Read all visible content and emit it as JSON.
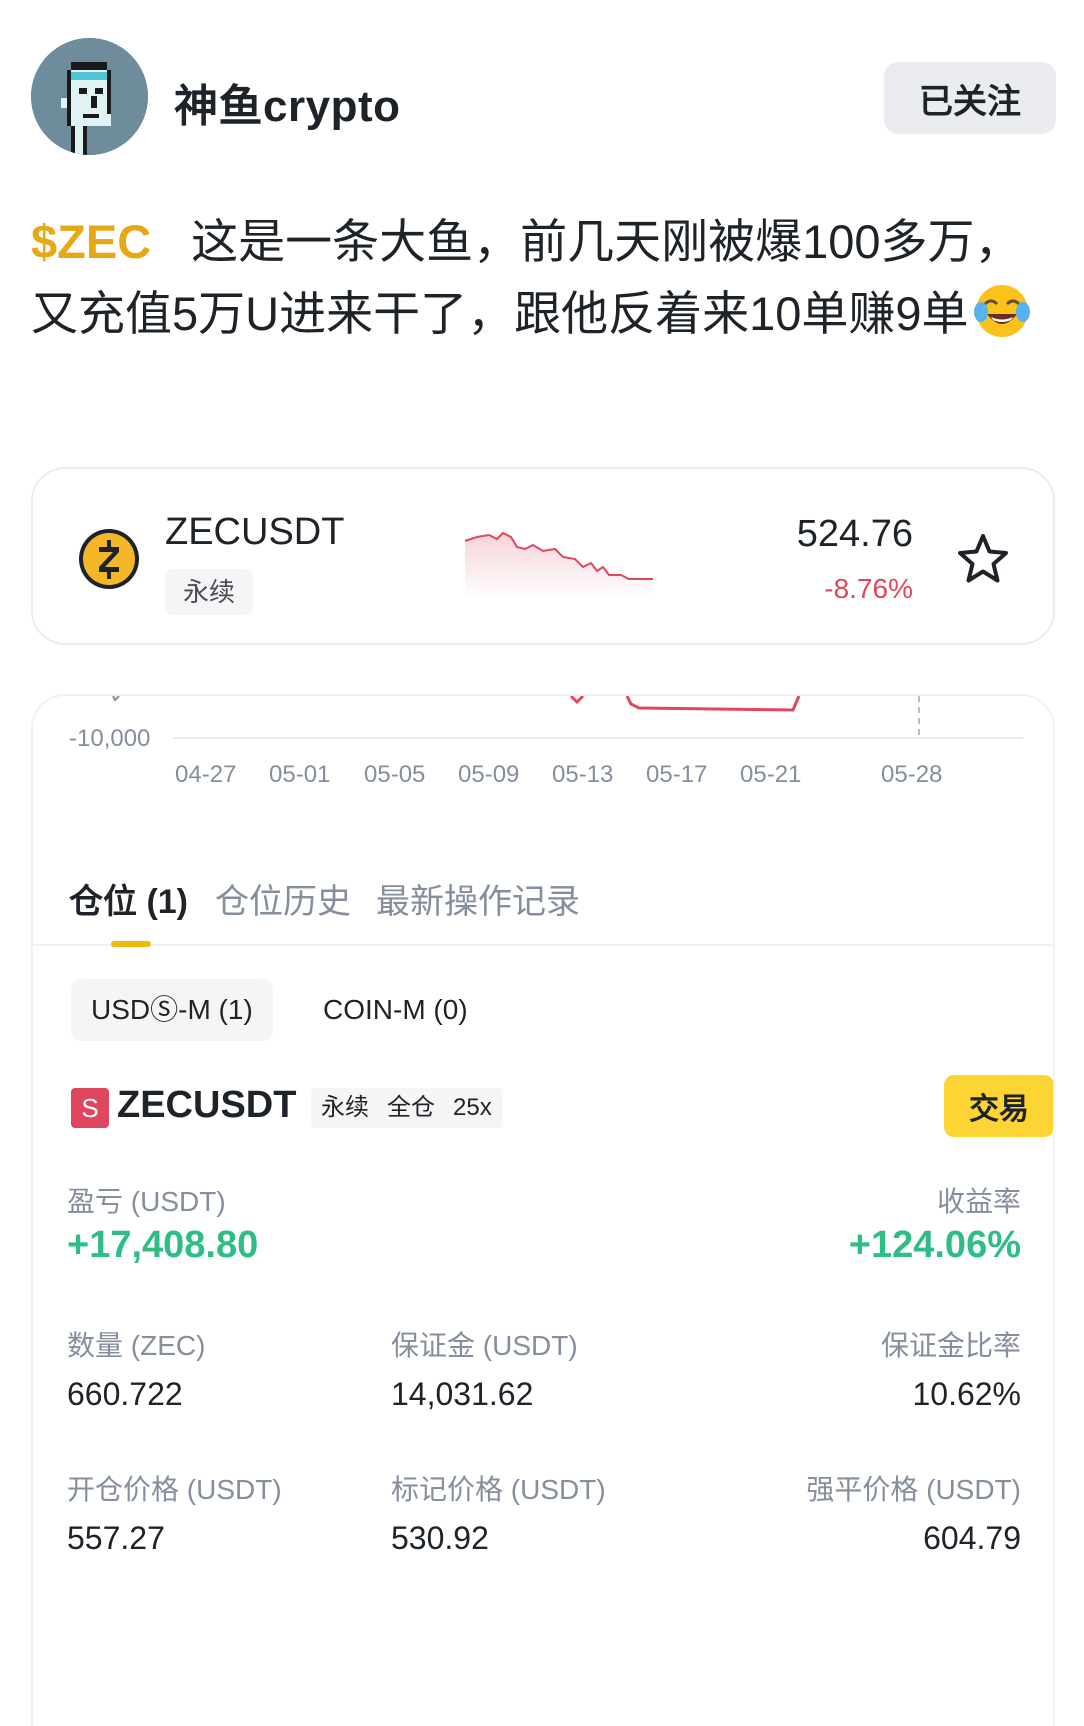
{
  "header": {
    "username": "神鱼crypto",
    "follow_label": "已关注"
  },
  "post": {
    "ticker": "$ZEC",
    "text": "这是一条大鱼，前几天刚被爆100多万，又充值5万U进来干了，跟他反着来10单赚9单",
    "emoji": "face-with-tears-of-joy"
  },
  "ticker_card": {
    "pair": "ZECUSDT",
    "type_tag": "永续",
    "price": "524.76",
    "change": "-8.76%",
    "change_color": "#e0475e"
  },
  "chart_data": {
    "type": "line",
    "y_visible_tick": "-10,000",
    "x_ticks": [
      "04-27",
      "05-01",
      "05-05",
      "05-09",
      "05-13",
      "05-17",
      "05-21",
      "05-28"
    ]
  },
  "tabs": {
    "positions": "仓位 (1)",
    "history": "仓位历史",
    "latest": "最新操作记录"
  },
  "subtabs": {
    "usds_m": "USDⓈ-M (1)",
    "coin_m": "COIN-M (0)"
  },
  "position": {
    "side_badge": "S",
    "pair": "ZECUSDT",
    "tags": [
      "永续",
      "全仓",
      "25x"
    ],
    "trade_label": "交易",
    "pnl_label": "盈亏 (USDT)",
    "pnl_value": "+17,408.80",
    "roi_label": "收益率",
    "roi_value": "+124.06%",
    "size_label": "数量 (ZEC)",
    "size_value": "660.722",
    "margin_label": "保证金 (USDT)",
    "margin_value": "14,031.62",
    "margin_ratio_label": "保证金比率",
    "margin_ratio_value": "10.62%",
    "entry_label": "开仓价格 (USDT)",
    "entry_value": "557.27",
    "mark_label": "标记价格 (USDT)",
    "mark_value": "530.92",
    "liq_label": "强平价格 (USDT)",
    "liq_value": "604.79",
    "positive_color": "#2ebd85",
    "accent_color": "#f0b90b"
  }
}
